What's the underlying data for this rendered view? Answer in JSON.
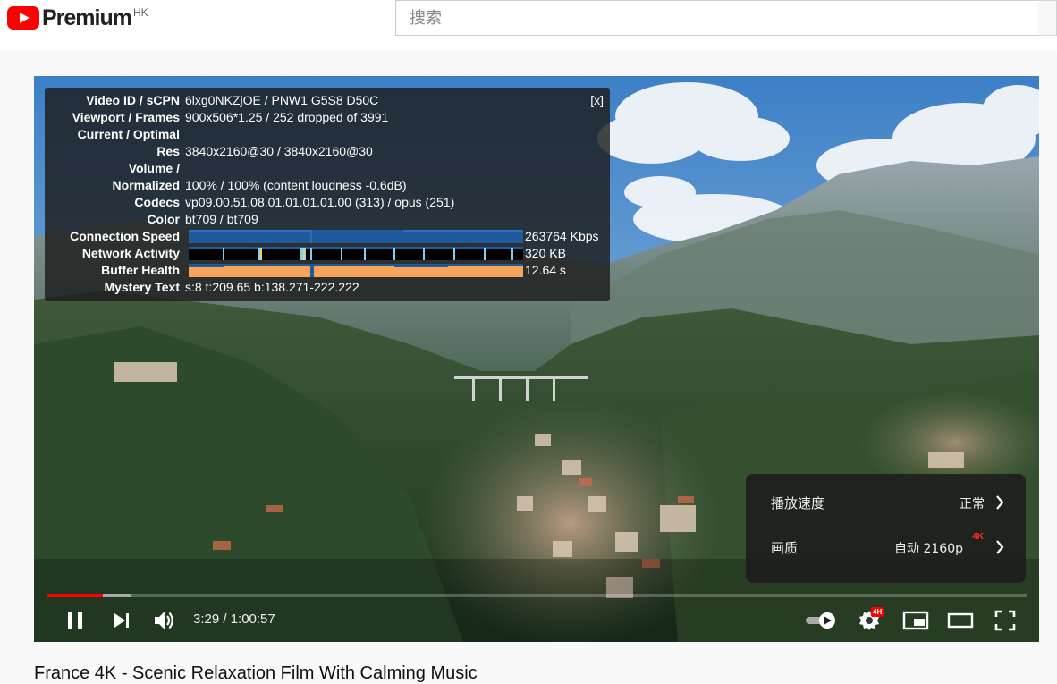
{
  "header": {
    "logo_text": "Premium",
    "logo_region": "HK",
    "search_placeholder": "搜索"
  },
  "stats": {
    "close_label": "[x]",
    "rows": [
      {
        "label": "Video ID / sCPN",
        "value": "6lxg0NKZjOE / PNW1 G5S8 D50C"
      },
      {
        "label": "Viewport / Frames",
        "value": "900x506*1.25 / 252 dropped of 3991"
      },
      {
        "label": "Current / Optimal",
        "value": ""
      },
      {
        "label": "Res",
        "value": "3840x2160@30 / 3840x2160@30"
      },
      {
        "label": "Volume /",
        "value": ""
      },
      {
        "label": "Normalized",
        "value": "100% / 100% (content loudness -0.6dB)"
      },
      {
        "label": "Codecs",
        "value": "vp09.00.51.08.01.01.01.01.00 (313) / opus (251)"
      },
      {
        "label": "Color",
        "value": "bt709 / bt709"
      }
    ],
    "graphs": [
      {
        "label": "Connection Speed",
        "value": "263764 Kbps"
      },
      {
        "label": "Network Activity",
        "value": "320 KB"
      },
      {
        "label": "Buffer Health",
        "value": "12.64 s"
      }
    ],
    "mystery": {
      "label": "Mystery Text",
      "value": "s:8 t:209.65 b:138.271-222.222"
    }
  },
  "settings_menu": {
    "items": [
      {
        "label": "播放速度",
        "value": "正常",
        "badge": ""
      },
      {
        "label": "画质",
        "value": "自动 2160p",
        "badge": "4K"
      }
    ]
  },
  "player": {
    "time_current": "3:29",
    "time_total": "1:00:57",
    "time_display": "3:29 / 1:00:57",
    "progress_played_fraction": 0.057,
    "progress_loaded_fraction": 0.085,
    "settings_badge": "4H"
  },
  "video": {
    "title": "France 4K - Scenic Relaxation Film With Calming Music"
  },
  "colors": {
    "accent": "#ff0000",
    "stats_bar_blue": "#1e5a9c",
    "stats_bar_orange": "#f7a55a"
  }
}
